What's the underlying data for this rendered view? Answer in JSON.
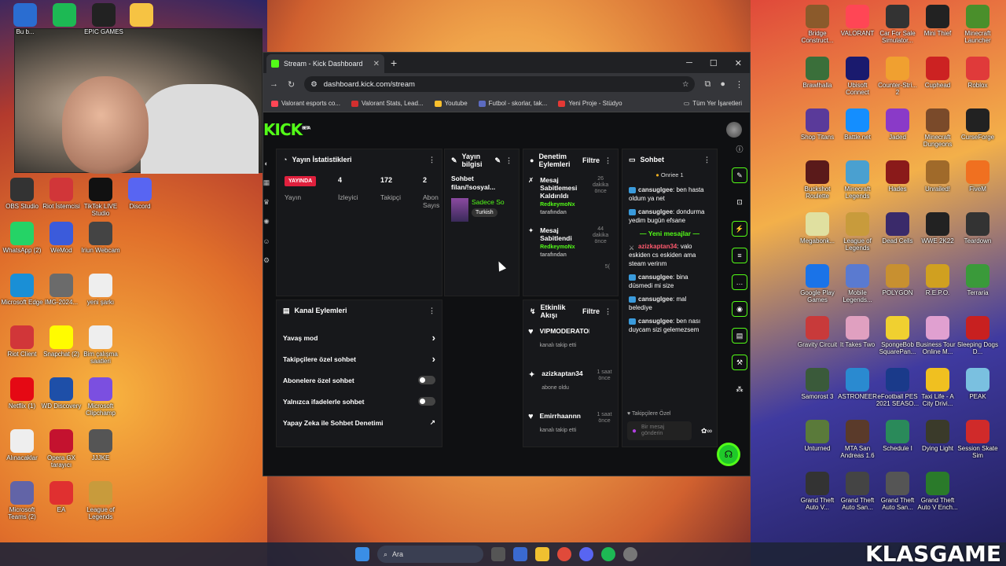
{
  "desktop": {
    "left_icons": [
      {
        "label": "Bu b...",
        "color": "#2a6dd1"
      },
      {
        "label": "",
        "color": "#1db954"
      },
      {
        "label": "EPIC GAMES",
        "color": "#222222"
      },
      {
        "label": "",
        "color": "#f6c343"
      },
      {
        "label": "OBS Studio",
        "color": "#333333"
      },
      {
        "label": "Riot İstemcisi",
        "color": "#d13639"
      },
      {
        "label": "TikTok LIVE Studio",
        "color": "#111111"
      },
      {
        "label": "Discord",
        "color": "#5865f2"
      },
      {
        "label": "WhatsApp (2)",
        "color": "#25d366"
      },
      {
        "label": "WeMod",
        "color": "#3b5bdb"
      },
      {
        "label": "Iriun Webcam",
        "color": "#444444"
      },
      {
        "label": "Microsoft Edge",
        "color": "#1a8fd6"
      },
      {
        "label": "IMG-2024...",
        "color": "#6b6b6b"
      },
      {
        "label": "yeni şarkı",
        "color": "#eeeeee"
      },
      {
        "label": "Riot Client",
        "color": "#d13639"
      },
      {
        "label": "Snapchat (2)",
        "color": "#fffc00"
      },
      {
        "label": "Bim çalışma saatleri",
        "color": "#eeeeee"
      },
      {
        "label": "Netflix (1)",
        "color": "#e50914"
      },
      {
        "label": "WD Discovery",
        "color": "#1e4fa8"
      },
      {
        "label": "Microsoft Clipchamp",
        "color": "#7b4fe0"
      },
      {
        "label": "Alınacaklar",
        "color": "#eeeeee"
      },
      {
        "label": "Opera GX tarayıcı",
        "color": "#c4122f"
      },
      {
        "label": "JJJKE",
        "color": "#555555"
      },
      {
        "label": "Microsoft Teams (2)",
        "color": "#6264a7"
      },
      {
        "label": "EA",
        "color": "#e03030"
      },
      {
        "label": "League of Legends",
        "color": "#c89b3c"
      }
    ],
    "right_icons": [
      {
        "label": "Bridge Construct...",
        "color": "#8b5a2b"
      },
      {
        "label": "VALORANT",
        "color": "#ff4655"
      },
      {
        "label": "Car For Sale Simulator...",
        "color": "#333333"
      },
      {
        "label": "Mini Thief",
        "color": "#222222"
      },
      {
        "label": "Minecraft Launcher",
        "color": "#4a8f2b"
      },
      {
        "label": "Brawlhalla",
        "color": "#3a6f3a"
      },
      {
        "label": "Ubisoft Connect",
        "color": "#1a1a6e"
      },
      {
        "label": "Counter-Stri... 2",
        "color": "#f0a030"
      },
      {
        "label": "Cuphead",
        "color": "#cc2222"
      },
      {
        "label": "Roblox",
        "color": "#e03a3a"
      },
      {
        "label": "Shop Titans",
        "color": "#5a3a9a"
      },
      {
        "label": "Battle.net",
        "color": "#148eff"
      },
      {
        "label": "Jaded",
        "color": "#8a3ac8"
      },
      {
        "label": "Minecraft Dungeons",
        "color": "#7a4a2a"
      },
      {
        "label": "CurseForge",
        "color": "#222222"
      },
      {
        "label": "Buckshot Roulette",
        "color": "#5a1a1a"
      },
      {
        "label": "Minecraft Legends",
        "color": "#4aa0d0"
      },
      {
        "label": "Hades",
        "color": "#8a1a1a"
      },
      {
        "label": "Unrailed!",
        "color": "#a06a2a"
      },
      {
        "label": "FiveM",
        "color": "#f07020"
      },
      {
        "label": "Megabonk...",
        "color": "#e0e0a0"
      },
      {
        "label": "League of Legends",
        "color": "#c89b3c"
      },
      {
        "label": "Dead Cells",
        "color": "#3a2a6a"
      },
      {
        "label": "WWE 2K22",
        "color": "#222222"
      },
      {
        "label": "Teardown",
        "color": "#333333"
      },
      {
        "label": "Google Play Games",
        "color": "#1a73e8"
      },
      {
        "label": "Mobile Legends...",
        "color": "#5a7ad0"
      },
      {
        "label": "POLYGON",
        "color": "#c89030"
      },
      {
        "label": "R.E.P.O.",
        "color": "#d0a020"
      },
      {
        "label": "Terraria",
        "color": "#3a9a3a"
      },
      {
        "label": "Gravity Circuit",
        "color": "#c83a3a"
      },
      {
        "label": "It Takes Two",
        "color": "#e0a0c0"
      },
      {
        "label": "SpongeBob SquarePan...",
        "color": "#f0d030"
      },
      {
        "label": "Business Tour - Online M...",
        "color": "#e0a0d0"
      },
      {
        "label": "Sleeping Dogs D...",
        "color": "#c82020"
      },
      {
        "label": "Samorost 3",
        "color": "#3a5a3a"
      },
      {
        "label": "ASTRONEER",
        "color": "#2a8ad0"
      },
      {
        "label": "eFootball PES 2021 SEASO...",
        "color": "#1a3a8a"
      },
      {
        "label": "Taxi Life - A City Drivi...",
        "color": "#f0c020"
      },
      {
        "label": "PEAK",
        "color": "#7ac0e0"
      },
      {
        "label": "Unturned",
        "color": "#5a7a3a"
      },
      {
        "label": "MTA San Andreas 1.6",
        "color": "#5a3a2a"
      },
      {
        "label": "Schedule I",
        "color": "#2a8a5a"
      },
      {
        "label": "Dying Light",
        "color": "#3a3a2a"
      },
      {
        "label": "Session Skate Sim",
        "color": "#d02a2a"
      },
      {
        "label": "Grand Theft Auto V...",
        "color": "#333333"
      },
      {
        "label": "Grand Theft Auto San...",
        "color": "#444444"
      },
      {
        "label": "Grand Theft Auto San...",
        "color": "#555555"
      },
      {
        "label": "Grand Theft Auto V Ench...",
        "color": "#2a7a2a"
      }
    ]
  },
  "browser": {
    "tab_title": "Stream - Kick Dashboard",
    "url": "dashboard.kick.com/stream",
    "bookmarks": [
      {
        "label": "Valorant esports co...",
        "color": "#ff4655"
      },
      {
        "label": "Valorant Stats, Lead...",
        "color": "#d32f2f"
      },
      {
        "label": "Youtube",
        "color": "#fbc02d"
      },
      {
        "label": "Futbol - skorlar, tak...",
        "color": "#5c6bc0"
      },
      {
        "label": "Yeni Proje - Stüdyo",
        "color": "#e53935"
      }
    ],
    "bookmarks_all": "Tüm Yer İşaretleri"
  },
  "kick": {
    "logo": "KICK",
    "logo_sup": "BETA",
    "stats": {
      "title": "Yayın İstatistikleri",
      "live_label": "YAYINDA",
      "stream_label": "Yayın",
      "viewers_value": "4",
      "viewers_label": "İzleyici",
      "followers_value": "172",
      "followers_label": "Takipçi",
      "subs_value": "2",
      "subs_label": "Abon Sayıs"
    },
    "info": {
      "title": "Yayın bilgisi",
      "stream_title": "Sohbet filan/!sosyal...",
      "category": "Sadece So",
      "tag": "Turkish"
    },
    "moderation": {
      "title": "Denetim Eylemleri",
      "filter": "Filtre",
      "items": [
        {
          "action": "Mesaj Sabitlemesi Kaldırıldı",
          "by": "RedkeymoNx",
          "by_suffix": "tarafından",
          "time": "26 dakika önce"
        },
        {
          "action": "Mesaj Sabitlendi",
          "by": "RedkeymoNx",
          "by_suffix": "tarafından",
          "time": "44 dakika önce"
        }
      ],
      "partial_time": "5("
    },
    "channel_actions": {
      "title": "Kanal Eylemleri",
      "items": [
        {
          "label": "Yavaş mod",
          "kind": "arrow"
        },
        {
          "label": "Takipçilere özel sohbet",
          "kind": "arrow"
        },
        {
          "label": "Abonelere özel sohbet",
          "kind": "toggle"
        },
        {
          "label": "Yalnızca ifadelerle sohbet",
          "kind": "toggle"
        },
        {
          "label": "Yapay Zeka ile Sohbet Denetimi",
          "kind": "external"
        }
      ]
    },
    "activity": {
      "title": "Etkinlik Akışı",
      "filter": "Filtre",
      "items": [
        {
          "user": "VIPMODERATORdr",
          "sub": "kanalı takip etti",
          "time": ""
        },
        {
          "user": "azizkaptan34",
          "sub": "abone oldu",
          "time": "1 saat önce"
        },
        {
          "user": "Emirrhaannn",
          "sub": "kanalı takip etti",
          "time": "1 saat önce"
        }
      ]
    },
    "chat": {
      "title": "Sohbet",
      "pinned": "Onriee 1",
      "messages": [
        {
          "user": "cansuglgee",
          "text": "ben hasta oldum ya net",
          "special": false
        },
        {
          "user": "cansuglgee",
          "text": "dondurma yedim bugün efsane",
          "special": false
        }
      ],
      "new_messages_label": "Yeni mesajlar",
      "new_messages": [
        {
          "user": "azizkaptan34",
          "text": "valo eskiden cs eskiden ama steam verirım",
          "special": true
        },
        {
          "user": "cansuglgee",
          "text": "bina düsmedi mi size",
          "special": false
        },
        {
          "user": "cansuglgee",
          "text": "mal belediye",
          "special": false
        },
        {
          "user": "cansuglgee",
          "text": "ben nası duycam sizi gelemezsem",
          "special": false
        }
      ],
      "followers_only": "Takipçilere Özel",
      "input_placeholder": "Bir mesaj gönderin"
    }
  },
  "taskbar": {
    "search_label": "Ara"
  },
  "watermark": "KLASGAME"
}
